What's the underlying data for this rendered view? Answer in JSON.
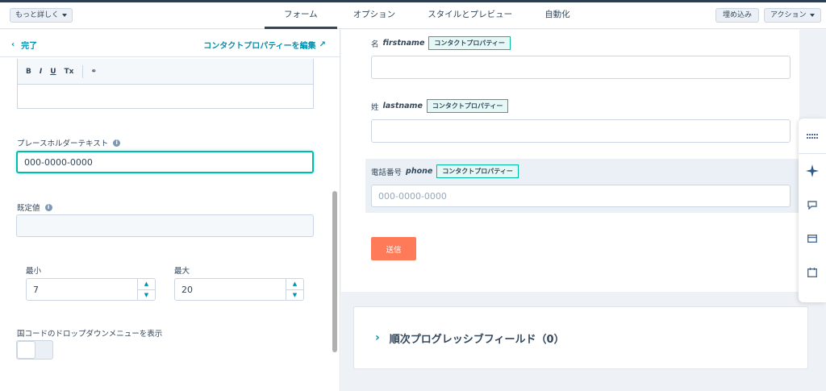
{
  "topbar": {
    "more_label": "もっと詳しく",
    "tabs": [
      "フォーム",
      "オプション",
      "スタイルとプレビュー",
      "自動化"
    ],
    "embed_label": "埋め込み",
    "action_label": "アクション"
  },
  "left_panel": {
    "done_label": "完了",
    "edit_property_label": "コンタクトプロパティーを編集",
    "toolbar": [
      "B",
      "I",
      "U",
      "Tx"
    ],
    "placeholder_label": "プレースホルダーテキスト",
    "placeholder_value": "000-0000-0000",
    "default_label": "既定値",
    "default_value": "",
    "min_label": "最小",
    "min_value": "7",
    "max_label": "最大",
    "max_value": "20",
    "country_dropdown_label": "国コードのドロップダウンメニューを表示",
    "toggle_on": false
  },
  "preview": {
    "fields": [
      {
        "label": "名",
        "name": "firstname",
        "chip": "コンタクトプロパティー",
        "value": ""
      },
      {
        "label": "姓",
        "name": "lastname",
        "chip": "コンタクトプロパティー",
        "value": ""
      },
      {
        "label": "電話番号",
        "name": "phone",
        "chip": "コンタクトプロパティー",
        "placeholder": "000-0000-0000"
      }
    ],
    "submit_label": "送信",
    "progressive_label": "順次プログレッシブフィールド（0）"
  },
  "side_rail": {
    "icons": [
      "grid-icon",
      "sparkle-icon",
      "chat-icon",
      "window-icon",
      "calendar-icon"
    ]
  },
  "colors": {
    "accent": "#0091ae",
    "submit": "#ff7a59",
    "chip_border": "#00bda5",
    "text": "#33475b"
  }
}
